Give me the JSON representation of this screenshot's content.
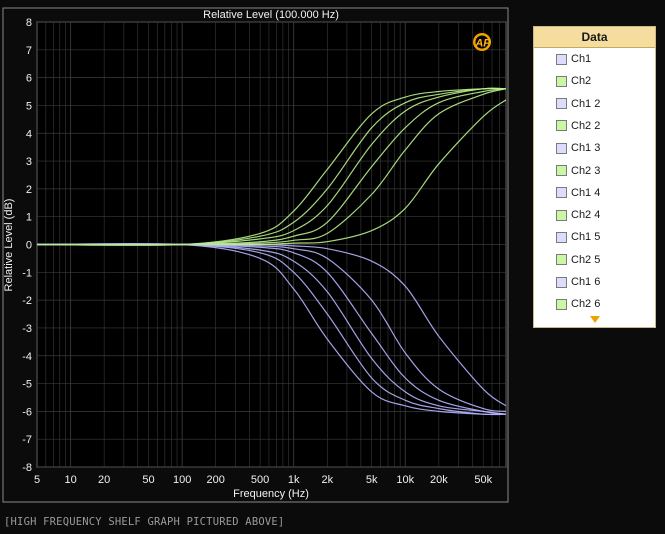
{
  "chart_data": {
    "type": "line",
    "title": "Relative Level (100.000 Hz)",
    "xlabel": "Frequency (Hz)",
    "ylabel": "Relative Level (dB)",
    "xscale": "log",
    "xlim": [
      5,
      80000
    ],
    "ylim": [
      -8,
      8
    ],
    "grid": true,
    "xticks": [
      {
        "value": 5,
        "label": "5"
      },
      {
        "value": 10,
        "label": "10"
      },
      {
        "value": 20,
        "label": "20"
      },
      {
        "value": 50,
        "label": "50"
      },
      {
        "value": 100,
        "label": "100"
      },
      {
        "value": 200,
        "label": "200"
      },
      {
        "value": 500,
        "label": "500"
      },
      {
        "value": 1000,
        "label": "1k"
      },
      {
        "value": 2000,
        "label": "2k"
      },
      {
        "value": 5000,
        "label": "5k"
      },
      {
        "value": 10000,
        "label": "10k"
      },
      {
        "value": 20000,
        "label": "20k"
      },
      {
        "value": 50000,
        "label": "50k"
      }
    ],
    "yticks": [
      8,
      7,
      6,
      5,
      4,
      3,
      2,
      1,
      0,
      -1,
      -2,
      -3,
      -4,
      -5,
      -6,
      -7,
      -8
    ],
    "series": [
      {
        "name": "Ch1",
        "color": "#b6b4ff",
        "x": [
          5,
          100,
          500,
          1000,
          2000,
          5000,
          10000,
          20000,
          50000,
          80000
        ],
        "y": [
          0,
          0,
          -0.5,
          -1.6,
          -3.4,
          -5.3,
          -5.8,
          -6.0,
          -6.1,
          -6.1
        ]
      },
      {
        "name": "Ch2",
        "color": "#b9f08a",
        "x": [
          5,
          100,
          500,
          1000,
          2000,
          5000,
          10000,
          20000,
          50000,
          80000
        ],
        "y": [
          0,
          0,
          0.4,
          1.2,
          2.7,
          4.7,
          5.3,
          5.5,
          5.6,
          5.6
        ]
      },
      {
        "name": "Ch1 2",
        "color": "#b6b4ff",
        "x": [
          5,
          100,
          500,
          1000,
          2000,
          5000,
          10000,
          20000,
          50000,
          80000
        ],
        "y": [
          0,
          0,
          -0.3,
          -1.0,
          -2.5,
          -4.8,
          -5.6,
          -5.9,
          -6.1,
          -6.1
        ]
      },
      {
        "name": "Ch2 2",
        "color": "#b9f08a",
        "x": [
          5,
          100,
          500,
          1000,
          2000,
          5000,
          10000,
          20000,
          50000,
          80000
        ],
        "y": [
          0,
          0,
          0.3,
          0.8,
          2.0,
          4.2,
          5.1,
          5.4,
          5.6,
          5.6
        ]
      },
      {
        "name": "Ch1 3",
        "color": "#b6b4ff",
        "x": [
          5,
          100,
          500,
          1000,
          2000,
          5000,
          10000,
          20000,
          50000,
          80000
        ],
        "y": [
          0,
          0,
          -0.2,
          -0.6,
          -1.7,
          -4.1,
          -5.3,
          -5.8,
          -6.0,
          -6.1
        ]
      },
      {
        "name": "Ch2 3",
        "color": "#b9f08a",
        "x": [
          5,
          100,
          500,
          1000,
          2000,
          5000,
          10000,
          20000,
          50000,
          80000
        ],
        "y": [
          0,
          0,
          0.2,
          0.5,
          1.4,
          3.6,
          4.8,
          5.3,
          5.6,
          5.6
        ]
      },
      {
        "name": "Ch1 4",
        "color": "#b6b4ff",
        "x": [
          5,
          100,
          500,
          1000,
          2000,
          5000,
          10000,
          20000,
          50000,
          80000
        ],
        "y": [
          0,
          0,
          -0.1,
          -0.3,
          -1.0,
          -3.2,
          -4.8,
          -5.6,
          -6.0,
          -6.1
        ]
      },
      {
        "name": "Ch2 4",
        "color": "#b9f08a",
        "x": [
          5,
          100,
          500,
          1000,
          2000,
          5000,
          10000,
          20000,
          50000,
          80000
        ],
        "y": [
          0,
          0,
          0.1,
          0.3,
          0.8,
          2.8,
          4.2,
          5.1,
          5.5,
          5.6
        ]
      },
      {
        "name": "Ch1 5",
        "color": "#b6b4ff",
        "x": [
          5,
          100,
          500,
          1000,
          2000,
          5000,
          10000,
          20000,
          50000,
          80000
        ],
        "y": [
          0,
          0,
          -0.05,
          -0.15,
          -0.5,
          -2.0,
          -3.9,
          -5.2,
          -5.9,
          -6.0
        ]
      },
      {
        "name": "Ch2 5",
        "color": "#b9f08a",
        "x": [
          5,
          100,
          500,
          1000,
          2000,
          5000,
          10000,
          20000,
          50000,
          80000
        ],
        "y": [
          0,
          0,
          0.05,
          0.15,
          0.4,
          1.8,
          3.4,
          4.7,
          5.4,
          5.6
        ]
      },
      {
        "name": "Ch1 6",
        "color": "#b6b4ff",
        "x": [
          5,
          100,
          500,
          1000,
          2000,
          5000,
          10000,
          20000,
          50000,
          80000
        ],
        "y": [
          0,
          0,
          0,
          -0.05,
          -0.15,
          -0.6,
          -1.5,
          -3.3,
          -5.2,
          -5.8
        ]
      },
      {
        "name": "Ch2 6",
        "color": "#b9f08a",
        "x": [
          5,
          100,
          500,
          1000,
          2000,
          5000,
          10000,
          20000,
          50000,
          80000
        ],
        "y": [
          0,
          0,
          0,
          0.05,
          0.1,
          0.5,
          1.3,
          2.9,
          4.6,
          5.2
        ]
      }
    ]
  },
  "colors": {
    "background": "#0b0b0b",
    "plot_bg": "#000000",
    "grid": "#3a3a3a",
    "ch1": "#b6b4ff",
    "ch2": "#b9f08a",
    "legend_header": "#f5dc9f"
  },
  "logo": {
    "text": "AP",
    "icon": "ap-logo-icon"
  },
  "legend": {
    "title": "Data",
    "more_icon": "scroll-down-arrow-icon"
  },
  "caption": "[HIGH FREQUENCY SHELF GRAPH PICTURED ABOVE]"
}
